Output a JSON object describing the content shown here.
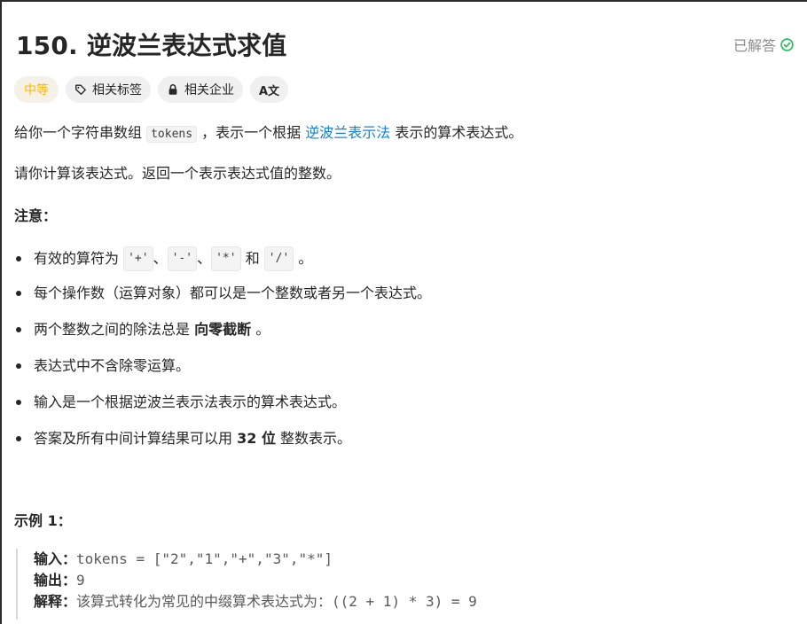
{
  "problem": {
    "title": "150. 逆波兰表达式求值",
    "status": "已解答"
  },
  "tags": {
    "difficulty": "中等",
    "related_tags": "相关标签",
    "related_companies": "相关企业",
    "translate": "A文"
  },
  "description": {
    "p1_pre": "给你一个字符串数组",
    "p1_code": "tokens",
    "p1_mid": "，表示一个根据",
    "p1_link": "逆波兰表示法",
    "p1_post": "表示的算术表达式。",
    "p2": "请你计算该表达式。返回一个表示表达式值的整数。",
    "note_title": "注意：",
    "b1_pre": "有效的算符为",
    "b1_c1": "'+'",
    "b1_sep1": "、",
    "b1_c2": "'-'",
    "b1_sep2": "、",
    "b1_c3": "'*'",
    "b1_and": "和",
    "b1_c4": "'/'",
    "b1_end": "。",
    "b2": "每个操作数（运算对象）都可以是一个整数或者另一个表达式。",
    "b3_pre": "两个整数之间的除法总是",
    "b3_bold": "向零截断",
    "b3_end": "。",
    "b4": "表达式中不含除零运算。",
    "b5": "输入是一个根据逆波兰表示法表示的算术表达式。",
    "b6_pre": "答案及所有中间计算结果可以用",
    "b6_bold": "32 位",
    "b6_end": "整数表示。"
  },
  "example": {
    "title": "示例 1：",
    "input_label": "输入：",
    "input_value": "tokens = [\"2\",\"1\",\"+\",\"3\",\"*\"]",
    "output_label": "输出：",
    "output_value": "9",
    "explain_label": "解释：",
    "explain_value": "该算式转化为常见的中缀算术表达式为：((2 + 1) * 3) = 9"
  },
  "colors": {
    "accent_link": "#1a7fd4",
    "difficulty_medium": "#ffb800",
    "solved_check": "#2cbb5d"
  }
}
